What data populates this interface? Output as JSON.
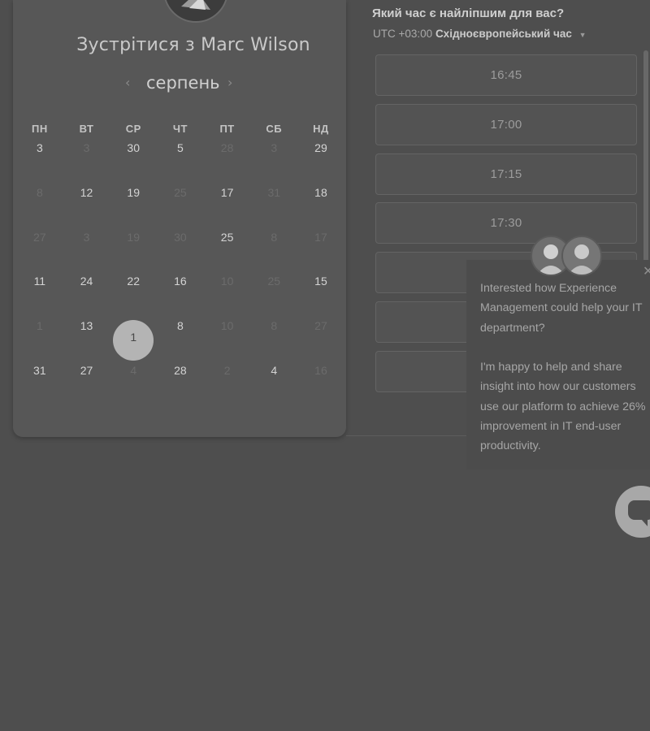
{
  "meeting": {
    "title": "Зустрітися з Marc Wilson"
  },
  "calendar": {
    "month": "серпень",
    "prev_icon": "chevron-left-icon",
    "next_icon": "chevron-right-icon",
    "weekdays": [
      "ПН",
      "ВТ",
      "СР",
      "ЧТ",
      "ПТ",
      "СБ",
      "НД"
    ],
    "weeks": [
      [
        {
          "d": "3",
          "on": true
        },
        {
          "d": "3",
          "on": false
        },
        {
          "d": "30",
          "on": true
        },
        {
          "d": "5",
          "on": true
        },
        {
          "d": "28",
          "on": false
        },
        {
          "d": "3",
          "on": false
        },
        {
          "d": "29",
          "on": true
        }
      ],
      [
        {
          "d": "8",
          "on": false
        },
        {
          "d": "12",
          "on": true
        },
        {
          "d": "19",
          "on": true
        },
        {
          "d": "25",
          "on": false
        },
        {
          "d": "17",
          "on": true
        },
        {
          "d": "31",
          "on": false
        },
        {
          "d": "18",
          "on": true
        }
      ],
      [
        {
          "d": "27",
          "on": false
        },
        {
          "d": "3",
          "on": false
        },
        {
          "d": "19",
          "on": false
        },
        {
          "d": "30",
          "on": false
        },
        {
          "d": "25",
          "on": true
        },
        {
          "d": "8",
          "on": false
        },
        {
          "d": "17",
          "on": false
        }
      ],
      [
        {
          "d": "11",
          "on": true
        },
        {
          "d": "24",
          "on": true
        },
        {
          "d": "22",
          "on": true
        },
        {
          "d": "16",
          "on": true
        },
        {
          "d": "10",
          "on": false
        },
        {
          "d": "25",
          "on": false
        },
        {
          "d": "15",
          "on": true
        }
      ],
      [
        {
          "d": "1",
          "on": false
        },
        {
          "d": "13",
          "on": true
        },
        {
          "d": "1",
          "on": true,
          "selected": true
        },
        {
          "d": "8",
          "on": true
        },
        {
          "d": "10",
          "on": false
        },
        {
          "d": "8",
          "on": false
        },
        {
          "d": "27",
          "on": false
        }
      ],
      [
        {
          "d": "31",
          "on": true
        },
        {
          "d": "27",
          "on": true
        },
        {
          "d": "4",
          "on": false
        },
        {
          "d": "28",
          "on": true
        },
        {
          "d": "2",
          "on": false
        },
        {
          "d": "4",
          "on": true
        },
        {
          "d": "16",
          "on": false
        }
      ]
    ]
  },
  "times": {
    "heading": "Який час є найліпшим для вас?",
    "tz_offset": "UTC +03:00",
    "tz_name": "Східноєвропейський час",
    "slots": [
      "16:45",
      "17:00",
      "17:15",
      "17:30",
      "",
      "",
      ""
    ]
  },
  "chat": {
    "message_1": "Interested how Experience Management could help your IT department?",
    "message_2": "I'm happy to help and share insight into how our customers use our platform to achieve 26% improvement in IT end-user productivity.",
    "close_icon": "close-icon",
    "launcher_icon": "chat-bubble-icon"
  }
}
